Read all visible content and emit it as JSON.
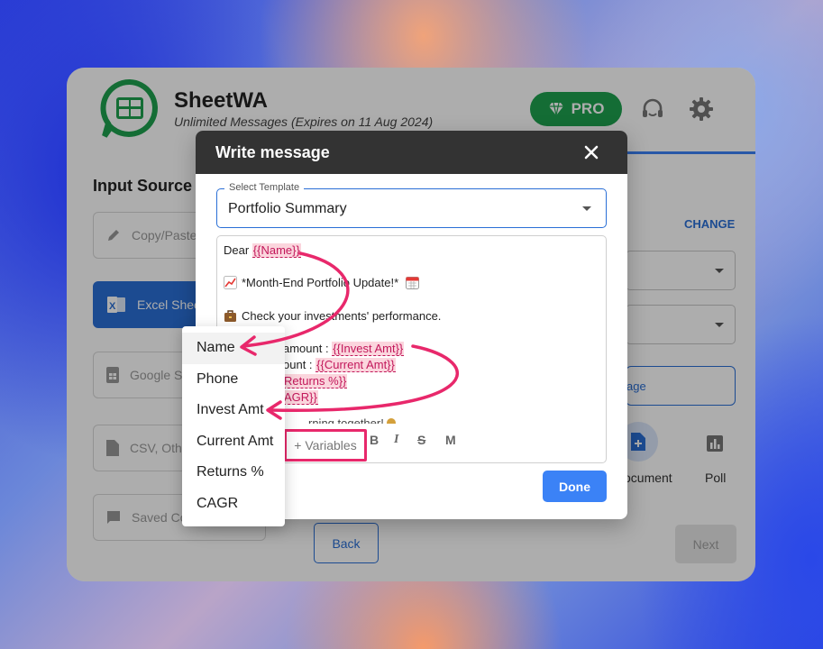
{
  "app": {
    "name": "SheetWA",
    "subtitle": "Unlimited Messages (Expires on 11 Aug 2024)",
    "pro_label": "PRO",
    "input_source_title": "Input Source",
    "sources": [
      {
        "label": "Copy/Paste",
        "icon": "pencil-icon"
      },
      {
        "label": "Excel Sheet",
        "icon": "excel-icon"
      },
      {
        "label": "Google Sheet",
        "icon": "google-sheet-icon"
      },
      {
        "label": "CSV, Other",
        "icon": "file-icon"
      },
      {
        "label": "Saved Contacts",
        "icon": "chat-icon"
      }
    ],
    "change_label": "CHANGE",
    "message_button_label": "age",
    "document_label": "ocument",
    "poll_label": "Poll",
    "back_label": "Back",
    "next_label": "Next"
  },
  "modal": {
    "title": "Write message",
    "template_label": "Select Template",
    "template_value": "Portfolio Summary",
    "message": {
      "greeting": "Dear ",
      "name_var": "{{Name}}",
      "update_line": "*Month-End Portfolio Update!*",
      "check_line": "Check your investments' performance.",
      "invest_prefix": "amount : ",
      "invest_var": "{{Invest Amt}}",
      "current_prefix": "ount : ",
      "current_var": "{{Current Amt}}",
      "returns_var": "Returns %}}",
      "cagr_var": "AGR}}",
      "partial_line": "rning together! "
    },
    "toolbar": {
      "variables_label": "+ Variables",
      "bold_label": "B",
      "italic_label": "I",
      "strike_label": "S",
      "mono_label": "M"
    },
    "done_label": "Done"
  },
  "variables_menu": {
    "items": [
      "Name",
      "Phone",
      "Invest Amt",
      "Current Amt",
      "Returns %",
      "CAGR"
    ]
  },
  "colors": {
    "accent": "#2a6fd6",
    "pro_green": "#1ea14f",
    "highlight_pink": "#e8286b",
    "variable_bg": "#fbd5dd"
  }
}
